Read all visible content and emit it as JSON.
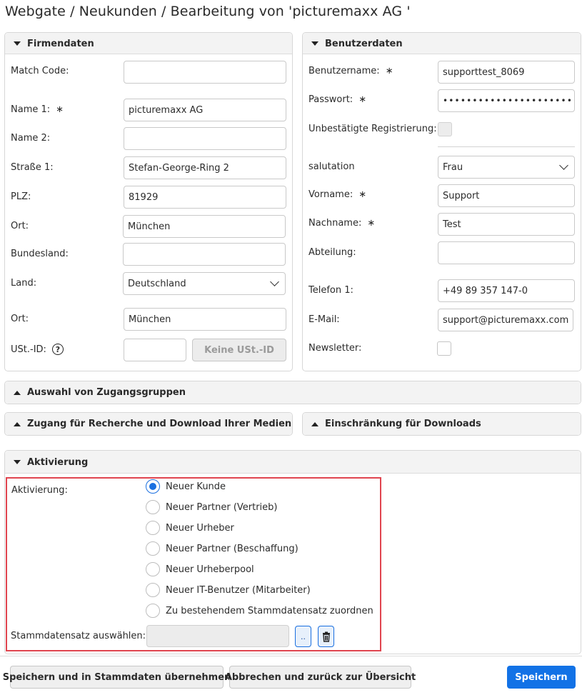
{
  "title": "Webgate / Neukunden / Bearbeitung von 'picturemaxx AG '",
  "firmendaten": {
    "heading": "Firmendaten",
    "match_code_label": "Match Code:",
    "match_code_value": "",
    "name1_label": "Name 1:",
    "name1_value": "picturemaxx AG",
    "name2_label": "Name 2:",
    "name2_value": "",
    "strasse_label": "Straße 1:",
    "strasse_value": "Stefan-George-Ring 2",
    "plz_label": "PLZ:",
    "plz_value": "81929",
    "ort_label": "Ort:",
    "ort_value": "München",
    "bundesland_label": "Bundesland:",
    "bundesland_value": "",
    "land_label": "Land:",
    "land_value": "Deutschland",
    "ort2_label": "Ort:",
    "ort2_value": "München",
    "ust_label": "USt.-ID:",
    "ust_value": "",
    "keine_ust_button": "Keine USt.-ID",
    "required_mark": "∗"
  },
  "benutzerdaten": {
    "heading": "Benutzerdaten",
    "benutzername_label": "Benutzername:",
    "benutzername_value": "supporttest_8069",
    "passwort_label": "Passwort:",
    "passwort_value": "•••••••••••••••••••••••••",
    "unbestaetigt_label": "Unbestätigte Registrierung:",
    "salutation_label": "salutation",
    "salutation_value": "Frau",
    "vorname_label": "Vorname:",
    "vorname_value": "Support",
    "nachname_label": "Nachname:",
    "nachname_value": "Test",
    "abteilung_label": "Abteilung:",
    "abteilung_value": "",
    "telefon_label": "Telefon 1:",
    "telefon_value": "+49 89 357 147-0",
    "email_label": "E-Mail:",
    "email_value": "support@picturemaxx.com",
    "newsletter_label": "Newsletter:",
    "newsletter_checked": false,
    "unbestaetigt_checked": false,
    "required_mark": "∗"
  },
  "sections": {
    "zugangsgruppen": "Auswahl von Zugangsgruppen",
    "recherche": "Zugang für Recherche und Download Ihrer Medien",
    "einschraenkung": "Einschränkung für Downloads",
    "aktivierung": "Aktivierung"
  },
  "aktivierung": {
    "label": "Aktivierung:",
    "options": [
      {
        "label": "Neuer Kunde",
        "selected": true
      },
      {
        "label": "Neuer Partner (Vertrieb)",
        "selected": false
      },
      {
        "label": "Neuer Urheber",
        "selected": false
      },
      {
        "label": "Neuer Partner (Beschaffung)",
        "selected": false
      },
      {
        "label": "Neuer Urheberpool",
        "selected": false
      },
      {
        "label": "Neuer IT-Benutzer (Mitarbeiter)",
        "selected": false
      },
      {
        "label": "Zu bestehendem Stammdatensatz zuordnen",
        "selected": false
      }
    ],
    "stammdaten_label": "Stammdatensatz auswählen:",
    "stammdaten_value": "",
    "browse_button": ".."
  },
  "footer": {
    "save_master_button": "Speichern und in Stammdaten übernehmen",
    "cancel_button": "Abbrechen und zurück zur Übersicht",
    "save_button": "Speichern"
  },
  "colors": {
    "accent": "#1272e6",
    "highlight": "#e0454f"
  }
}
